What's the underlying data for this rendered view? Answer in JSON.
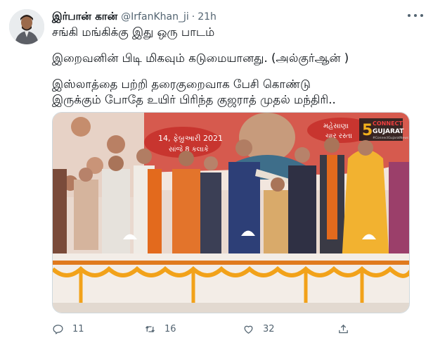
{
  "tweet": {
    "author_name": "இர்பான் கான்",
    "handle": "@IrfanKhan_ji",
    "separator": "·",
    "time": "21h",
    "lines": [
      "சங்கி மங்கிக்கு இது ஒரு பாடம்",
      "இறைவனின் பிடி மிகவும் கடுமையானது. (அல்குர்ஆன் )",
      "இஸ்லாத்தை பற்றி தரைகுறைவாக பேசி கொண்டு",
      "இருக்கும் போதே உயிர் பிரிந்த குஜராத் முதல் மந்திரி.."
    ]
  },
  "media": {
    "banner_date_text": "14, ફેબ્રુઆરી 2021",
    "banner_date_sub": "સાંજે 8 કલાકે",
    "banner_right_text": "મહેસાણા",
    "banner_right_sub": "ચાર રસ્તા",
    "watermark_line1": "CONNECT",
    "watermark_line2": "GUJARAT",
    "watermark_line3": "#ConnectGujaratNews"
  },
  "actions": {
    "reply_count": "11",
    "retweet_count": "16",
    "like_count": "32"
  },
  "colors": {
    "text_primary": "#0f1419",
    "text_secondary": "#536471",
    "banner_red": "#c8352f",
    "stage_orange": "#e07a1e",
    "marigold": "#f2a21a"
  },
  "icons": {
    "reply": "reply-icon",
    "retweet": "retweet-icon",
    "like": "heart-icon",
    "share": "share-icon",
    "more": "more-icon"
  }
}
